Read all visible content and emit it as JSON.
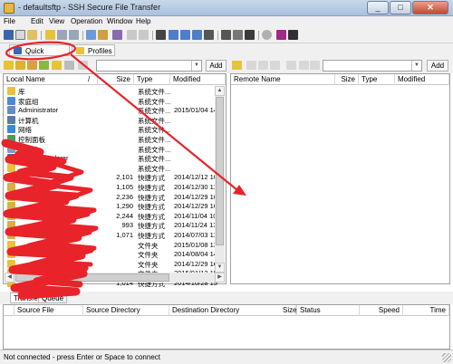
{
  "window": {
    "title": "- defaultsftp - SSH Secure File Transfer",
    "minimize": "_",
    "maximize": "□",
    "close": "✕"
  },
  "menu": {
    "file": "File",
    "edit": "Edit",
    "view": "View",
    "operation": "Operation",
    "window": "Window",
    "help": "Help"
  },
  "tabs": {
    "quick_connect": "Quick Connect",
    "profiles": "Profiles"
  },
  "local": {
    "add_label": "Add",
    "path_value": "",
    "columns": {
      "name": "Local Name",
      "sort_marker": "/",
      "size": "Size",
      "type": "Type",
      "modified": "Modified"
    },
    "rows": [
      {
        "icon": "library-icon",
        "name": "库",
        "size": "",
        "type": "系统文件...",
        "modified": ""
      },
      {
        "icon": "homegroup-icon",
        "name": "家庭组",
        "size": "",
        "type": "系统文件...",
        "modified": ""
      },
      {
        "icon": "user-folder-icon",
        "name": "Administrator",
        "size": "",
        "type": "系统文件...",
        "modified": "2015/01/04 14"
      },
      {
        "icon": "computer-icon",
        "name": "计算机",
        "size": "",
        "type": "系统文件...",
        "modified": ""
      },
      {
        "icon": "network-icon",
        "name": "网络",
        "size": "",
        "type": "系统文件...",
        "modified": ""
      },
      {
        "icon": "control-panel-icon",
        "name": "控制面板",
        "size": "",
        "type": "系统文件...",
        "modified": ""
      },
      {
        "icon": "recycle-bin-icon",
        "name": "回收站",
        "size": "",
        "type": "系统文件...",
        "modified": ""
      },
      {
        "icon": "internet-explorer-icon",
        "name": "Internet Explorer",
        "size": "",
        "type": "系统文件...",
        "modified": ""
      },
      {
        "icon": "folder-icon",
        "name": "",
        "size": "",
        "type": "系统文件...",
        "modified": ""
      },
      {
        "icon": "shortcut-icon",
        "name": "",
        "size": "2,101",
        "type": "快捷方式",
        "modified": "2014/12/12 10"
      },
      {
        "icon": "shortcut-icon",
        "name": "",
        "size": "1,105",
        "type": "快捷方式",
        "modified": "2014/12/30 11"
      },
      {
        "icon": "shortcut-icon",
        "name": "",
        "size": "2,236",
        "type": "快捷方式",
        "modified": "2014/12/29 16"
      },
      {
        "icon": "shortcut-icon",
        "name": "",
        "size": "1,290",
        "type": "快捷方式",
        "modified": "2014/12/29 16"
      },
      {
        "icon": "shortcut-icon",
        "name": "",
        "size": "2,244",
        "type": "快捷方式",
        "modified": "2014/11/04 10"
      },
      {
        "icon": "shortcut-icon",
        "name": "",
        "size": "993",
        "type": "快捷方式",
        "modified": "2014/11/24 13"
      },
      {
        "icon": "shortcut-icon",
        "name": "",
        "size": "1,071",
        "type": "快捷方式",
        "modified": "2014/07/03 11"
      },
      {
        "icon": "folder-icon",
        "name": "",
        "size": "",
        "type": "文件夹",
        "modified": "2015/01/08 13"
      },
      {
        "icon": "folder-icon",
        "name": "",
        "size": "",
        "type": "文件夹",
        "modified": "2014/08/04 14"
      },
      {
        "icon": "folder-icon",
        "name": "",
        "size": "",
        "type": "文件夹",
        "modified": "2014/12/29 16"
      },
      {
        "icon": "folder-icon",
        "name": "",
        "size": "",
        "type": "文件夹",
        "modified": "2015/01/13 15"
      },
      {
        "icon": "folder-icon",
        "name": "",
        "size": "1,014",
        "type": "快捷方式",
        "modified": "2014/10/28 15"
      }
    ]
  },
  "remote": {
    "add_label": "Add",
    "path_value": "",
    "columns": {
      "name": "Remote Name",
      "size": "Size",
      "type": "Type",
      "modified": "Modified"
    },
    "rows": []
  },
  "transfer": {
    "tabs": {
      "transfer": "Transfer",
      "queue": "Queue"
    },
    "columns": {
      "source_file": "Source File",
      "source_dir": "Source Directory",
      "dest_dir": "Destination Directory",
      "size": "Size",
      "status": "Status",
      "speed": "Speed",
      "time": "Time"
    }
  },
  "status": {
    "message": "Not connected - press Enter or Space to connect"
  },
  "colors": {
    "annotation_red": "#e8232a",
    "titlebar": "#b9cce4",
    "chrome": "#f0f0f0"
  }
}
